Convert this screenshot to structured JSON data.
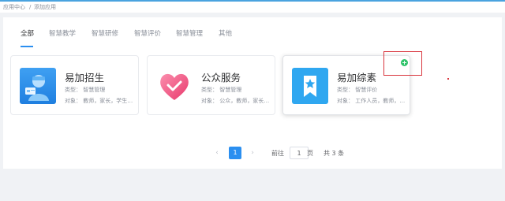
{
  "breadcrumb": {
    "home": "应用中心",
    "separator": "/",
    "current": "添加应用"
  },
  "tabs": [
    {
      "label": "全部",
      "active": true
    },
    {
      "label": "智慧教学"
    },
    {
      "label": "智慧研修"
    },
    {
      "label": "智慧评价"
    },
    {
      "label": "智慧管理"
    },
    {
      "label": "其他"
    }
  ],
  "apps": [
    {
      "name": "易加招生",
      "type": "类型：  智慧管理",
      "target": "对象：  教师，家长，学生，..."
    },
    {
      "name": "公众服务",
      "type": "类型：  智慧管理",
      "target": "对象：  公众，教师，家长，..."
    },
    {
      "name": "易加综素",
      "type": "类型：  智慧评价",
      "target": "对象：  工作人员，教师，家..."
    }
  ],
  "add_button": {
    "symbol": "+"
  },
  "pagination": {
    "prev": "‹",
    "next": "›",
    "current_page": "1",
    "goto_label": "前往",
    "goto_value": "1",
    "page_unit": "页",
    "total": "共 3 条"
  },
  "colors": {
    "accent": "#2b8ff0",
    "add_green": "#2fc36a",
    "annotation_red": "#d9363e"
  }
}
